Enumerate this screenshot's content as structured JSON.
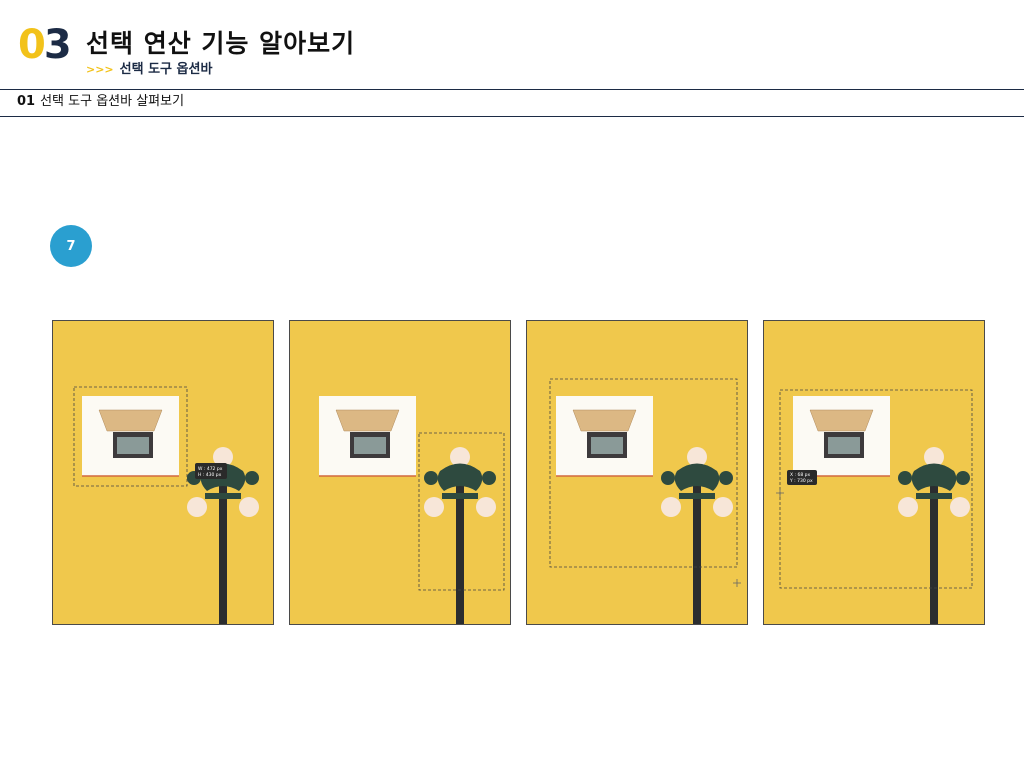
{
  "header": {
    "chapter_digit_1": "0",
    "chapter_digit_2": "3",
    "title": "선택 연산 기능 알아보기",
    "subtitle_arrows": ">>>",
    "subtitle": "선택 도구 옵션바"
  },
  "section": {
    "number": "01",
    "label": "선택 도구 옵션바 살펴보기"
  },
  "step": {
    "number": "7"
  },
  "panels": [
    {
      "tooltip_line1": "W : 472 px",
      "tooltip_line2": "H : 430 px"
    },
    {},
    {},
    {
      "tooltip_line1": "X : 68 px",
      "tooltip_line2": "Y : 730 px"
    }
  ],
  "colors": {
    "accent_yellow": "#f2c21a",
    "navy": "#1c2b45",
    "badge_blue": "#2a9fd0",
    "wall_yellow": "#f0c84c"
  }
}
